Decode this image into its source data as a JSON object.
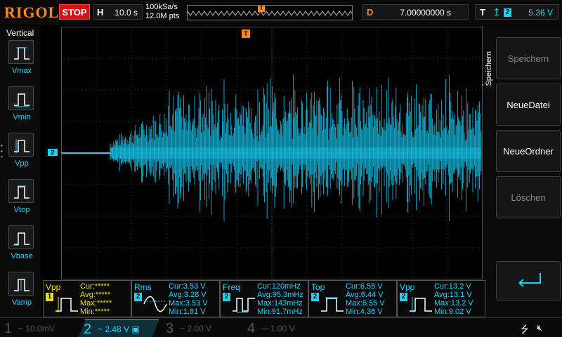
{
  "topbar": {
    "logo": "RIGOL",
    "run_state": "STOP",
    "timebase_label": "H",
    "timebase_value": "10.0 s",
    "sample_rate": "100kSa/s",
    "memory_depth": "12.0M pts",
    "trigger_marker": "T",
    "delay_label": "D",
    "delay_value": "7.00000000 s",
    "trigger_label": "T",
    "trigger_channel": "2",
    "trigger_level": "5.36 V"
  },
  "left_menu": {
    "title": "Vertical",
    "items": [
      {
        "label": "Vmax",
        "icon": "vmax-pulse-icon"
      },
      {
        "label": "Vmin",
        "icon": "vmin-pulse-icon"
      },
      {
        "label": "Vpp",
        "icon": "vpp-pulse-icon"
      },
      {
        "label": "Vtop",
        "icon": "vtop-pulse-icon"
      },
      {
        "label": "Vbase",
        "icon": "vbase-pulse-icon"
      },
      {
        "label": "Vamp",
        "icon": "vamp-pulse-icon"
      }
    ]
  },
  "waveform": {
    "channel_marker": "2",
    "trigger_marker": "T",
    "color": "#1ad4ff"
  },
  "right_menu": {
    "title": "Speichern",
    "buttons": [
      {
        "label": "Speichern",
        "enabled": false
      },
      {
        "label": "NeueDatei",
        "enabled": true
      },
      {
        "label": "NeueOrdner",
        "enabled": true
      },
      {
        "label": "Löschen",
        "enabled": false
      }
    ],
    "enter_icon": "enter-arrow-icon"
  },
  "measurements": [
    {
      "name": "Vpp",
      "channel": "1",
      "badge_color": "#f0e000",
      "value_color": "#f0e000",
      "cur": "Cur:*****",
      "avg": "Avg:*****",
      "max": "Max:*****",
      "min": "Min:*****"
    },
    {
      "name": "Rms",
      "channel": "2",
      "badge_color": "#1ad4ff",
      "value_color": "#1ad4ff",
      "cur": "Cur:3.53 V",
      "avg": "Avg:3.28 V",
      "max": "Max:3.53 V",
      "min": "Min:1.81 V"
    },
    {
      "name": "Freq",
      "channel": "2",
      "badge_color": "#1ad4ff",
      "value_color": "#1ad4ff",
      "cur": "Cur:120mHz",
      "avg": "Avg:95.3mHz",
      "max": "Max:143mHz",
      "min": "Min:91.7mHz"
    },
    {
      "name": "Top",
      "channel": "2",
      "badge_color": "#1ad4ff",
      "value_color": "#1ad4ff",
      "cur": "Cur:6.55 V",
      "avg": "Avg:6.44 V",
      "max": "Max:6.55 V",
      "min": "Min:4.36 V"
    },
    {
      "name": "Vpp",
      "channel": "2",
      "badge_color": "#1ad4ff",
      "value_color": "#1ad4ff",
      "cur": "Cur:13.2 V",
      "avg": "Avg:13.1 V",
      "max": "Max:13.2 V",
      "min": "Min:9.02 V"
    }
  ],
  "channels": [
    {
      "num": "1",
      "coupling": "~",
      "scale": "10.0mV",
      "active": false
    },
    {
      "num": "2",
      "coupling": "~",
      "scale": "2.48 V",
      "active": true
    },
    {
      "num": "3",
      "coupling": "~",
      "scale": "2.00 V",
      "active": false
    },
    {
      "num": "4",
      "coupling": "",
      "scale": "1.00 V",
      "active": false
    }
  ],
  "status_icons": [
    "usb-icon",
    "mute-icon"
  ]
}
